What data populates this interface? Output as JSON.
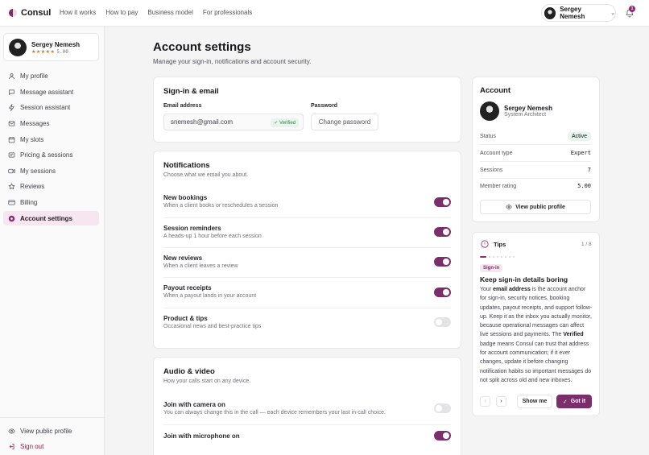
{
  "app": {
    "name": "Consul"
  },
  "topnav": [
    "How it works",
    "How to pay",
    "Business model",
    "For professionals"
  ],
  "user": {
    "name": "Sergey Nemesh",
    "stars": "★★★★★",
    "rating": "5.00",
    "role": "System Architect",
    "notifications": "1"
  },
  "sidebar": {
    "items": [
      {
        "label": "My profile",
        "icon": "user-icon"
      },
      {
        "label": "Message assistant",
        "icon": "chat-icon"
      },
      {
        "label": "Session assistant",
        "icon": "bolt-icon"
      },
      {
        "label": "Messages",
        "icon": "mail-icon"
      },
      {
        "label": "My slots",
        "icon": "calendar-icon"
      },
      {
        "label": "Pricing & sessions",
        "icon": "receipt-icon"
      },
      {
        "label": "My sessions",
        "icon": "video-icon"
      },
      {
        "label": "Reviews",
        "icon": "star-icon"
      },
      {
        "label": "Billing",
        "icon": "card-icon"
      },
      {
        "label": "Account settings",
        "icon": "gear-icon"
      }
    ],
    "view_public": "View public profile",
    "sign_out": "Sign out"
  },
  "page": {
    "title": "Account settings",
    "subtitle": "Manage your sign-in, notifications and account security."
  },
  "signin": {
    "title": "Sign-in & email",
    "email_label": "Email address",
    "email_value": "snemesh@gmail.com",
    "verified": "✓ Verified",
    "password_label": "Password",
    "change_password": "Change password"
  },
  "notifications": {
    "title": "Notifications",
    "subtitle": "Choose what we email you about.",
    "items": [
      {
        "title": "New bookings",
        "desc": "When a client books or reschedules a session",
        "on": true
      },
      {
        "title": "Session reminders",
        "desc": "A heads-up 1 hour before each session",
        "on": true
      },
      {
        "title": "New reviews",
        "desc": "When a client leaves a review",
        "on": true
      },
      {
        "title": "Payout receipts",
        "desc": "When a payout lands in your account",
        "on": true
      },
      {
        "title": "Product & tips",
        "desc": "Occasional news and best-practice tips",
        "on": false
      }
    ]
  },
  "av": {
    "title": "Audio & video",
    "subtitle": "How your calls start on any device.",
    "items": [
      {
        "title": "Join with camera on",
        "desc": "You can always change this in the call — each device remembers your last in-call choice.",
        "on": false
      },
      {
        "title": "Join with microphone on",
        "desc": "",
        "on": true
      }
    ]
  },
  "account": {
    "title": "Account",
    "rows": [
      {
        "label": "Status",
        "value": "Active"
      },
      {
        "label": "Account type",
        "value": "Expert"
      },
      {
        "label": "Sessions",
        "value": "7"
      },
      {
        "label": "Member rating",
        "value": "5.00"
      }
    ],
    "view_public": "View public profile"
  },
  "tips": {
    "title": "Tips",
    "counter": "1 / 8",
    "chip": "Sign-in",
    "heading": "Keep sign-in details boring",
    "b1_pre": "Your ",
    "b1_bold": "email address",
    "b1_post": " is the account anchor for sign-in, security notices, booking updates, payout receipts, and support follow-up. Keep it as the inbox you actually monitor, because operational messages can affect live sessions and payments. The ",
    "b2_bold": "Verified",
    "b2_post": " badge means Consul can trust that address for account communication; if it ever changes, update it before changing notification habits so important messages do not split across old and new inboxes.",
    "show_me": "Show me",
    "got_it": "Got it"
  },
  "colors": {
    "accent": "#7a2f6a",
    "accent_soft": "#f6e6f0",
    "success": "#2f7d47"
  }
}
